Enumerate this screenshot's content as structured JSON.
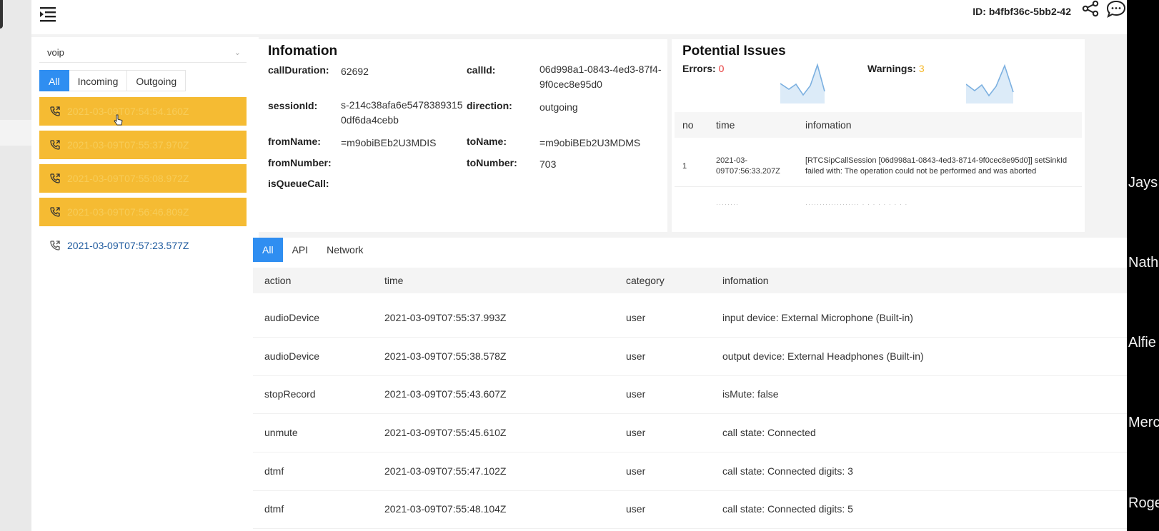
{
  "header": {
    "session_id": "ID: b4fbf36c-5bb2-42"
  },
  "sidebar": {
    "select_value": "voip",
    "tabs": [
      "All",
      "Incoming",
      "Outgoing"
    ],
    "calls": [
      "2021-03-09T07:54:54.160Z",
      "2021-03-09T07:55:37.970Z",
      "2021-03-09T07:55:08.972Z",
      "2021-03-09T07:56:46.809Z",
      "2021-03-09T07:57:23.577Z"
    ]
  },
  "info": {
    "title": "Infomation",
    "call_duration_label": "callDuration:",
    "call_duration": "62692",
    "call_id_label": "callId:",
    "call_id": "06d998a1-0843-4ed3-87f4-9f0cec8e95d0",
    "session_id_label": "sessionId:",
    "session_id": "s-214c38afa6e54783893150df6da4cebb",
    "direction_label": "direction:",
    "direction": "outgoing",
    "from_name_label": "fromName:",
    "from_name": "=m9obiBEb2U3MDIS",
    "to_name_label": "toName:",
    "to_name": "=m9obiBEb2U3MDMS",
    "from_number_label": "fromNumber:",
    "from_number": "",
    "to_number_label": "toNumber:",
    "to_number": "703",
    "is_queue_call_label": "isQueueCall:"
  },
  "issues": {
    "title": "Potential Issues",
    "errors_label": "Errors:",
    "errors": "0",
    "warnings_label": "Warnings:",
    "warnings": "3",
    "columns": [
      "no",
      "time",
      "infomation"
    ],
    "rows": [
      {
        "no": "1",
        "time_date": "2021-03-",
        "time_clock": "09T07:56:33.207Z",
        "info_line1": "[RTCSipCallSession [06d998a1-0843-4ed3-8714-9f0cec8e95d0]] setSinkId",
        "info_line2": "failed with: The operation could not be performed and was aborted"
      }
    ]
  },
  "main": {
    "tabs": [
      "All",
      "API",
      "Network"
    ],
    "columns": [
      "action",
      "time",
      "category",
      "infomation"
    ],
    "rows": [
      {
        "action": "audioDevice",
        "time": "2021-03-09T07:55:37.993Z",
        "category": "user",
        "info": "input device: External Microphone (Built-in)"
      },
      {
        "action": "audioDevice",
        "time": "2021-03-09T07:55:38.578Z",
        "category": "user",
        "info": "output device: External Headphones (Built-in)"
      },
      {
        "action": "stopRecord",
        "time": "2021-03-09T07:55:43.607Z",
        "category": "user",
        "info": "isMute: false"
      },
      {
        "action": "unmute",
        "time": "2021-03-09T07:55:45.610Z",
        "category": "user",
        "info": "call state: Connected"
      },
      {
        "action": "dtmf",
        "time": "2021-03-09T07:55:47.102Z",
        "category": "user",
        "info": "call state: Connected digits: 3"
      },
      {
        "action": "dtmf",
        "time": "2021-03-09T07:55:48.104Z",
        "category": "user",
        "info": "call state: Connected digits: 5"
      }
    ]
  },
  "side_names": [
    "Jays",
    "Nath",
    "Alfie",
    "Merc",
    "Roge"
  ],
  "colors": {
    "accent": "#2f8ef1",
    "highlight": "#f5bb33",
    "error": "#e63b3b",
    "warning": "#f5b82a"
  }
}
